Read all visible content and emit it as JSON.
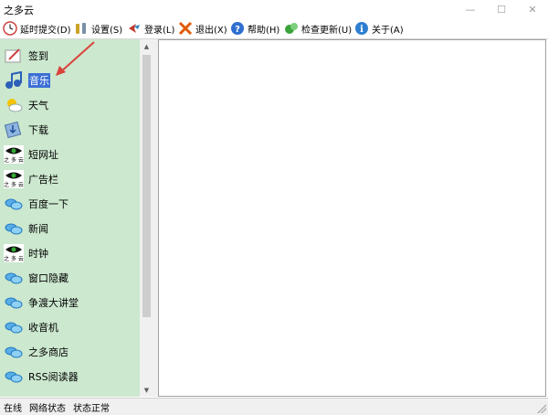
{
  "window": {
    "title": "之多云",
    "minimize": "—",
    "maximize": "☐",
    "close": "✕"
  },
  "toolbar": [
    {
      "label": "延时提交(D)",
      "icon": "clock-icon"
    },
    {
      "label": "设置(S)",
      "icon": "wrench-icon"
    },
    {
      "label": "登录(L)",
      "icon": "login-icon"
    },
    {
      "label": "退出(X)",
      "icon": "exit-icon"
    },
    {
      "label": "帮助(H)",
      "icon": "help-icon"
    },
    {
      "label": "检查更新(U)",
      "icon": "update-icon"
    },
    {
      "label": "关于(A)",
      "icon": "info-icon"
    }
  ],
  "sidebar": {
    "items": [
      {
        "label": "签到",
        "icon": "signin-icon"
      },
      {
        "label": "音乐",
        "icon": "music-icon",
        "selected": true
      },
      {
        "label": "天气",
        "icon": "weather-icon"
      },
      {
        "label": "下载",
        "icon": "download-icon"
      },
      {
        "label": "短网址",
        "icon": "eye-icon"
      },
      {
        "label": "广告栏",
        "icon": "eye-icon"
      },
      {
        "label": "百度一下",
        "icon": "cloud-icon"
      },
      {
        "label": "新闻",
        "icon": "cloud-icon"
      },
      {
        "label": "时钟",
        "icon": "eye-icon"
      },
      {
        "label": "窗口隐藏",
        "icon": "cloud-icon"
      },
      {
        "label": "争渡大讲堂",
        "icon": "cloud-icon"
      },
      {
        "label": "收音机",
        "icon": "cloud-icon"
      },
      {
        "label": "之多商店",
        "icon": "cloud-icon"
      },
      {
        "label": "RSS阅读器",
        "icon": "cloud-icon"
      }
    ]
  },
  "statusbar": {
    "online": "在线",
    "network": "网络状态",
    "status": "状态正常"
  },
  "eye_icon_caption": "之 多 云",
  "colors": {
    "sidebar_bg": "#cce8cf",
    "selection": "#3b6fd4",
    "annotation_arrow": "#d9433b"
  }
}
